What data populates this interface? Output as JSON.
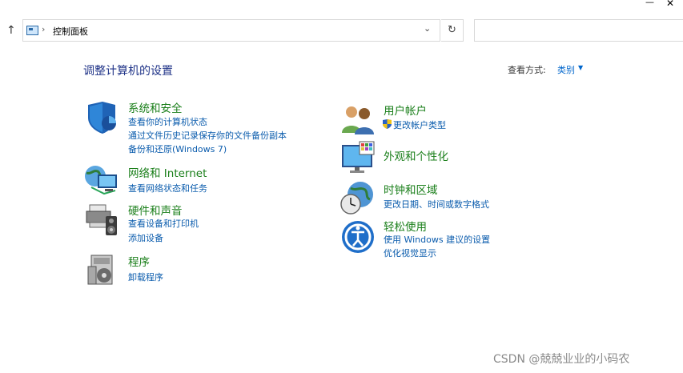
{
  "window": {
    "minimize_glyph": "—",
    "close_glyph": "✕"
  },
  "address_bar": {
    "location_icon": "control-panel-icon",
    "separator": "›",
    "path": "控制面板",
    "dropdown_glyph": "⌄",
    "refresh_glyph": "↻",
    "up_glyph": "↑",
    "search_placeholder": ""
  },
  "header": {
    "title": "调整计算机的设置",
    "view_label": "查看方式:",
    "view_value": "类别",
    "view_arrow": "▼"
  },
  "left_column": [
    {
      "icon": "system-security-icon",
      "title": "系统和安全",
      "links": [
        "查看你的计算机状态",
        "通过文件历史记录保存你的文件备份副本",
        "备份和还原(Windows 7)"
      ]
    },
    {
      "icon": "network-internet-icon",
      "title": "网络和 Internet",
      "links": [
        "查看网络状态和任务"
      ]
    },
    {
      "icon": "hardware-sound-icon",
      "title": "硬件和声音",
      "links": [
        "查看设备和打印机",
        "添加设备"
      ]
    },
    {
      "icon": "programs-icon",
      "title": "程序",
      "links": [
        "卸载程序"
      ]
    }
  ],
  "right_column": [
    {
      "icon": "user-accounts-icon",
      "title": "用户帐户",
      "links": [
        "更改帐户类型"
      ]
    },
    {
      "icon": "appearance-icon",
      "title": "外观和个性化",
      "links": []
    },
    {
      "icon": "clock-region-icon",
      "title": "时钟和区域",
      "links": [
        "更改日期、时间或数字格式"
      ]
    },
    {
      "icon": "ease-of-access-icon",
      "title": "轻松使用",
      "links": [
        "使用 Windows 建议的设置",
        "优化视觉显示"
      ]
    }
  ],
  "watermark": "CSDN @兢兢业业的小码农",
  "colors": {
    "title_green": "#1a7f1a",
    "link_blue": "#0b5cad",
    "heading_blue": "#1e3287"
  }
}
